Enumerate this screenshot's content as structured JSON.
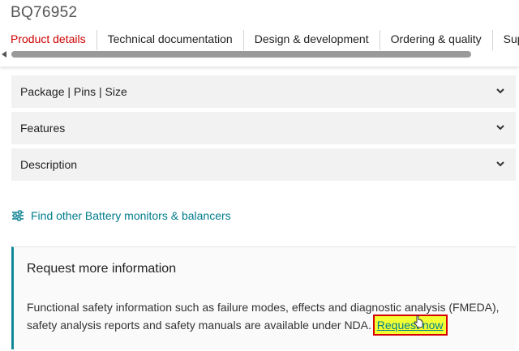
{
  "header": {
    "part_number": "BQ76952",
    "tabs": [
      {
        "label": "Product details",
        "active": true
      },
      {
        "label": "Technical documentation",
        "active": false
      },
      {
        "label": "Design & development",
        "active": false
      },
      {
        "label": "Ordering & quality",
        "active": false
      },
      {
        "label": "Support",
        "active": false
      }
    ]
  },
  "accordions": [
    {
      "label": "Package | Pins | Size"
    },
    {
      "label": "Features"
    },
    {
      "label": "Description"
    }
  ],
  "find_link": {
    "label": "Find other Battery monitors & balancers",
    "icon": "sliders-icon"
  },
  "info_card": {
    "title": "Request more information",
    "text": "Functional safety information such as failure modes, effects and diagnostic analysis (FMEDA), safety analysis reports and safety manuals are available under NDA.",
    "request_link": "Request now"
  },
  "colors": {
    "active_tab": "#cc0000",
    "link": "#007c8c",
    "card_accent": "#118899",
    "highlight": "#f2ff33"
  }
}
